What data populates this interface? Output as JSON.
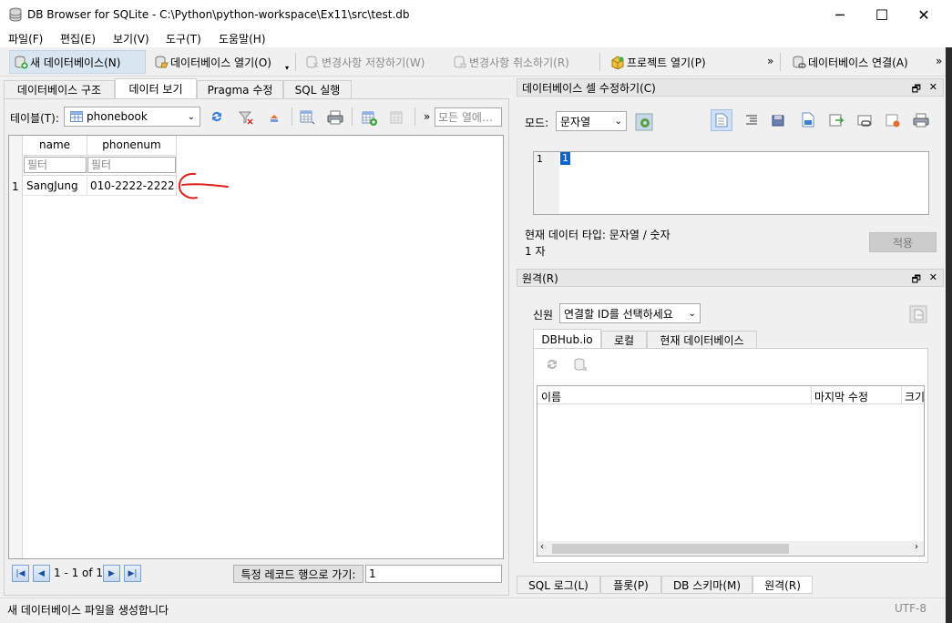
{
  "window": {
    "title": "DB Browser for SQLite - C:\\Python\\python-workspace\\Ex11\\src\\test.db",
    "minimize": "─",
    "maximize": "☐",
    "close": "✕"
  },
  "menu": [
    "파일(F)",
    "편집(E)",
    "보기(V)",
    "도구(T)",
    "도움말(H)"
  ],
  "toolbar": {
    "new_db": "새 데이터베이스(N)",
    "open_db": "데이터베이스 열기(O)",
    "write_changes": "변경사항 저장하기(W)",
    "revert_changes": "변경사항 취소하기(R)",
    "open_project": "프로젝트 열기(P)",
    "attach_db": "데이터베이스 연결(A)",
    "more": "»"
  },
  "left_tabs": [
    "데이터베이스 구조",
    "데이터 보기",
    "Pragma 수정",
    "SQL 실행"
  ],
  "browse": {
    "table_label": "테이블(T):",
    "table_value": "phonebook",
    "search_placeholder": "모든 열에…",
    "columns": [
      "name",
      "phonenum"
    ],
    "filter_placeholder": "필터",
    "rows": [
      {
        "num": "1",
        "name": "SangJung",
        "phonenum": "010-2222-2222"
      }
    ],
    "record_info": "1 - 1 of 1",
    "goto_button": "특정 레코드 행으로 가기:",
    "goto_value": "1"
  },
  "edit_cell": {
    "title": "데이터베이스 셀 수정하기(C)",
    "mode_label": "모드:",
    "mode_value": "문자열",
    "line_number": "1",
    "cell_value": "1",
    "type_info": "현재 데이터 타입: 문자열 / 숫자",
    "size_info": "1 자",
    "apply_button": "적용"
  },
  "remote": {
    "title": "원격(R)",
    "identity_label": "신원",
    "identity_value": "연결할 ID를 선택하세요",
    "tabs": [
      "DBHub.io",
      "로컬",
      "현재 데이터베이스"
    ],
    "columns": [
      "이름",
      "마지막 수정",
      "크기"
    ]
  },
  "bottom_tabs": [
    "SQL 로그(L)",
    "플롯(P)",
    "DB 스키마(M)",
    "원격(R)"
  ],
  "status": {
    "message": "새 데이터베이스 파일을 생성합니다",
    "encoding": "UTF-8"
  },
  "colors": {
    "annotation": "#e0201c",
    "selection": "#0a64d2",
    "accent_blue": "#3b7fd4"
  }
}
